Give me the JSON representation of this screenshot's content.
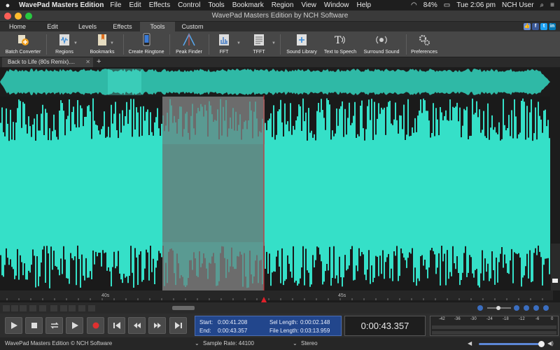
{
  "menubar": {
    "app_name": "WavePad Masters Edition",
    "items": [
      "File",
      "Edit",
      "Effects",
      "Control",
      "Tools",
      "Bookmark",
      "Region",
      "View",
      "Window",
      "Help"
    ],
    "battery": "84%",
    "clock": "Tue 2:06 pm",
    "user": "NCH User"
  },
  "window": {
    "title": "WavePad Masters Edition by NCH Software"
  },
  "ribbon": {
    "tabs": [
      "Home",
      "Edit",
      "Levels",
      "Effects",
      "Tools",
      "Custom"
    ],
    "active_tab": "Tools",
    "social": [
      "f",
      "t",
      "in"
    ]
  },
  "toolbar": {
    "tools": [
      {
        "label": "Batch Converter",
        "icon": "batch-converter-icon"
      },
      {
        "label": "Regions",
        "icon": "regions-icon"
      },
      {
        "label": "Bookmarks",
        "icon": "bookmarks-icon"
      },
      {
        "label": "Create Ringtone",
        "icon": "ringtone-icon"
      },
      {
        "label": "Peak Finder",
        "icon": "peak-finder-icon"
      },
      {
        "label": "FFT",
        "icon": "fft-icon"
      },
      {
        "label": "TFFT",
        "icon": "tfft-icon"
      },
      {
        "label": "Sound Library",
        "icon": "sound-library-icon"
      },
      {
        "label": "Text to Speech",
        "icon": "text-to-speech-icon"
      },
      {
        "label": "Surround Sound",
        "icon": "surround-sound-icon"
      },
      {
        "label": "Preferences",
        "icon": "preferences-icon"
      }
    ]
  },
  "document": {
    "tab_title": "Back to Life (80s Remix)....",
    "add_tab": "+"
  },
  "timeline": {
    "labels": [
      "40s",
      "45s"
    ]
  },
  "colors": {
    "wave": "#35e0c8",
    "wave_dark": "#2aa898",
    "selection": "#6c6c6c",
    "overview_bg": "#2fb9a6",
    "playhead": "#e0202a"
  },
  "selection": {
    "start_label": "Start:",
    "start": "0:00:41.208",
    "end_label": "End:",
    "end": "0:00:43.357",
    "sel_length_label": "Sel Length:",
    "sel_length": "0:00:02.148",
    "file_length_label": "File Length:",
    "file_length": "0:03:13.959"
  },
  "current_time": "0:00:43.357",
  "meter": {
    "scale": [
      "-42",
      "-36",
      "-30",
      "-24",
      "-18",
      "-12",
      "-6",
      "0"
    ]
  },
  "status": {
    "copyright": "WavePad Masters Edition © NCH Software",
    "sample_rate": "Sample Rate: 44100",
    "channels": "Stereo"
  }
}
